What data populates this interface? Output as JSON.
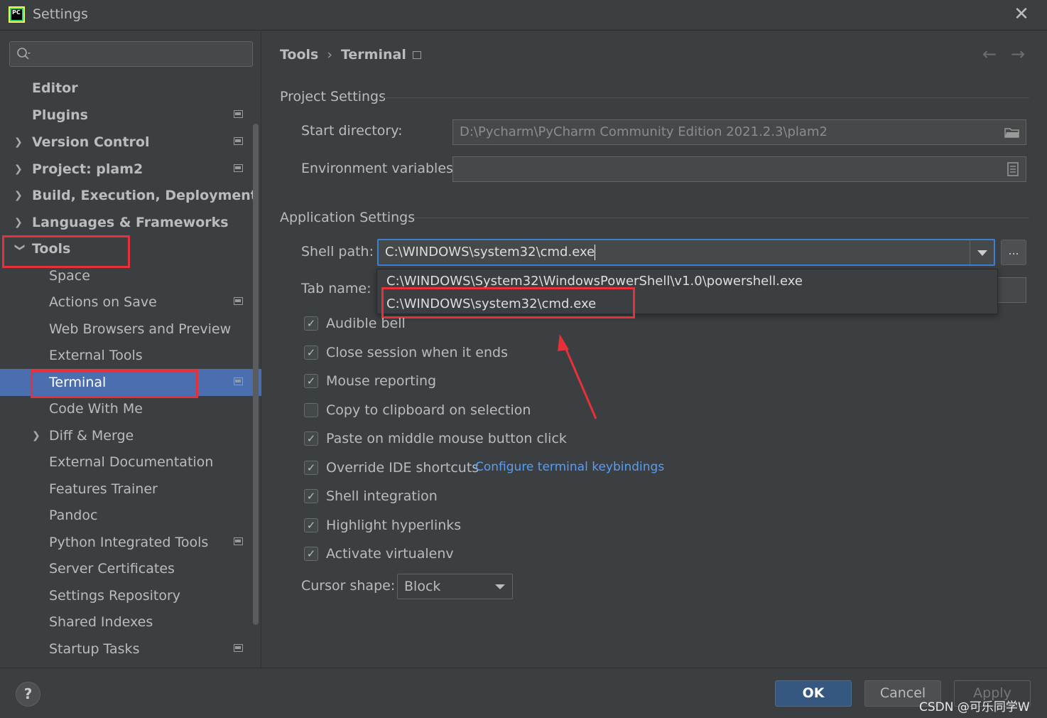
{
  "window": {
    "title": "Settings",
    "app_icon_text": "PC"
  },
  "search": {
    "placeholder": ""
  },
  "sidebar": {
    "items": [
      {
        "label": "Editor"
      },
      {
        "label": "Plugins"
      },
      {
        "label": "Version Control"
      },
      {
        "label": "Project: plam2"
      },
      {
        "label": "Build, Execution, Deployment"
      },
      {
        "label": "Languages & Frameworks"
      },
      {
        "label": "Tools"
      },
      {
        "label": "Space"
      },
      {
        "label": "Actions on Save"
      },
      {
        "label": "Web Browsers and Preview"
      },
      {
        "label": "External Tools"
      },
      {
        "label": "Terminal"
      },
      {
        "label": "Code With Me"
      },
      {
        "label": "Diff & Merge"
      },
      {
        "label": "External Documentation"
      },
      {
        "label": "Features Trainer"
      },
      {
        "label": "Pandoc"
      },
      {
        "label": "Python Integrated Tools"
      },
      {
        "label": "Server Certificates"
      },
      {
        "label": "Settings Repository"
      },
      {
        "label": "Shared Indexes"
      },
      {
        "label": "Startup Tasks"
      }
    ]
  },
  "breadcrumb": {
    "parent": "Tools",
    "separator": "›",
    "current": "Terminal"
  },
  "project_settings": {
    "title": "Project Settings",
    "start_directory_label": "Start directory:",
    "start_directory_value": "D:\\Pycharm\\PyCharm Community Edition 2021.2.3\\plam2",
    "env_vars_label": "Environment variables:",
    "env_vars_value": ""
  },
  "application_settings": {
    "title": "Application Settings",
    "shell_path_label": "Shell path:",
    "shell_path_value": "C:\\WINDOWS\\system32\\cmd.exe",
    "browse_label": "...",
    "shell_options": [
      "C:\\WINDOWS\\System32\\WindowsPowerShell\\v1.0\\powershell.exe",
      "C:\\WINDOWS\\system32\\cmd.exe"
    ],
    "tab_name_label": "Tab name:",
    "checkboxes": [
      {
        "label": "Audible bell",
        "checked": true
      },
      {
        "label": "Close session when it ends",
        "checked": true
      },
      {
        "label": "Mouse reporting",
        "checked": true
      },
      {
        "label": "Copy to clipboard on selection",
        "checked": false
      },
      {
        "label": "Paste on middle mouse button click",
        "checked": true
      },
      {
        "label": "Override IDE shortcuts",
        "checked": true
      },
      {
        "label": "Shell integration",
        "checked": true
      },
      {
        "label": "Highlight hyperlinks",
        "checked": true
      },
      {
        "label": "Activate virtualenv",
        "checked": true
      }
    ],
    "keybindings_link": "Configure terminal keybindings",
    "cursor_shape_label": "Cursor shape:",
    "cursor_shape_value": "Block"
  },
  "footer": {
    "help": "?",
    "ok": "OK",
    "cancel": "Cancel",
    "apply": "Apply"
  },
  "watermark": "CSDN @可乐同学W",
  "colors": {
    "selection": "#4b6eaf",
    "highlight_box": "#e8303a",
    "link": "#589df6",
    "focus": "#3d7fd1"
  }
}
